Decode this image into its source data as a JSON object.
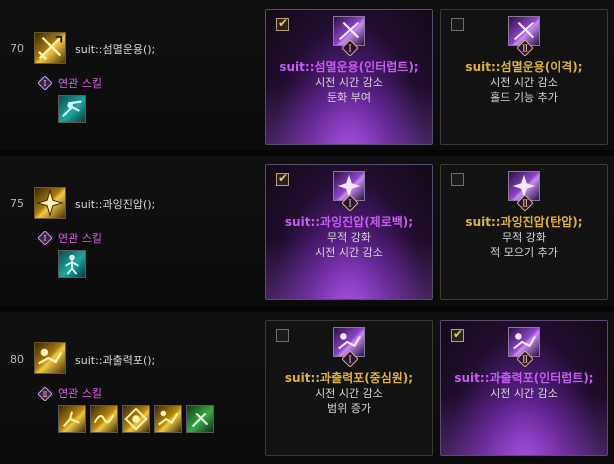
{
  "colors": {
    "accent_purple": "#c75cf0",
    "accent_gold": "#e0b040",
    "related_text": "#e05fe8"
  },
  "rows": [
    {
      "level": "70",
      "skill_name": "suit::섬멸운용();",
      "skill_icon": "crossed-blades-icon",
      "rank_badge": "Ⅰ",
      "related_label": "연관 스킬",
      "related_icons": [
        "slash-dash-icon"
      ],
      "cards": [
        {
          "checked": true,
          "selected": true,
          "rank": "Ⅰ",
          "icon": "blade-burst-icon",
          "title": "suit::섬멸운용(인터럽트);",
          "lines": [
            "시전 시간 감소",
            "둔화 부여"
          ]
        },
        {
          "checked": false,
          "selected": false,
          "rank": "Ⅱ",
          "icon": "blade-burst-icon",
          "title": "suit::섬멸운용(이격);",
          "lines": [
            "시전 시간 감소",
            "홀드 기능 추가"
          ]
        }
      ]
    },
    {
      "level": "75",
      "skill_name": "suit::과잉진압();",
      "skill_icon": "star-burst-icon",
      "rank_badge": "Ⅰ",
      "related_label": "연관 스킬",
      "related_icons": [
        "figure-stance-icon"
      ],
      "cards": [
        {
          "checked": true,
          "selected": true,
          "rank": "Ⅰ",
          "icon": "star-burst-icon",
          "title": "suit::과잉진압(제로백);",
          "lines": [
            "무적 강화",
            "시전 시간 감소"
          ]
        },
        {
          "checked": false,
          "selected": false,
          "rank": "Ⅱ",
          "icon": "star-burst-icon",
          "title": "suit::과잉진압(탄압);",
          "lines": [
            "무적 강화",
            "적 모으기 추가"
          ]
        }
      ]
    },
    {
      "level": "80",
      "skill_name": "suit::과출력포();",
      "skill_icon": "cannon-blast-icon",
      "rank_badge": "Ⅱ",
      "related_label": "연관 스킬",
      "related_icons": [
        "kick-strike-icon",
        "energy-wave-icon",
        "target-burst-icon",
        "cannon-blast-icon",
        "green-dash-icon"
      ],
      "cards": [
        {
          "checked": false,
          "selected": false,
          "rank": "Ⅰ",
          "icon": "cannon-blast-icon",
          "title": "suit::과출력포(중심원);",
          "lines": [
            "시전 시간 감소",
            "범위 증가"
          ]
        },
        {
          "checked": true,
          "selected": true,
          "rank": "Ⅱ",
          "icon": "cannon-blast-icon",
          "title": "suit::과출력포(인터럽트);",
          "lines": [
            "시전 시간 감소",
            ""
          ]
        }
      ]
    }
  ]
}
